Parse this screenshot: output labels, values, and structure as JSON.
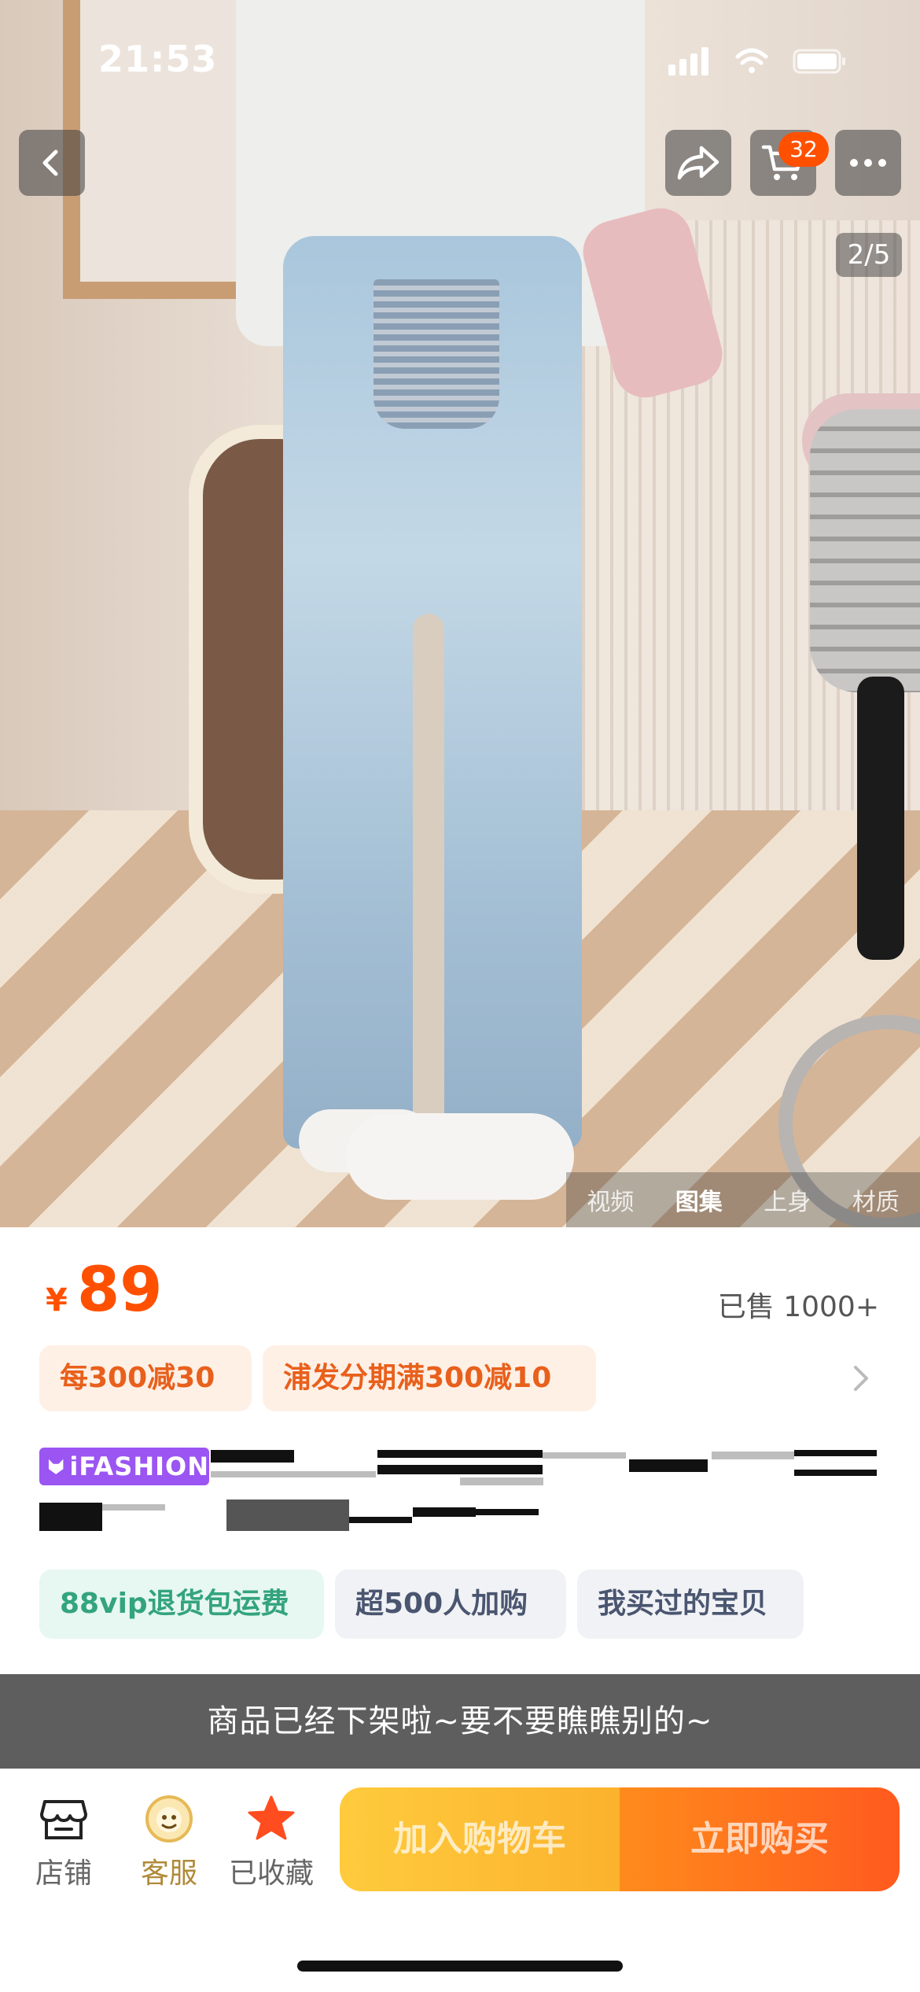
{
  "status_bar": {
    "time": "21:53"
  },
  "top_nav": {
    "cart_count": "32",
    "page_indicator": "2/5"
  },
  "media_tabs": [
    "视频",
    "图集",
    "上身",
    "材质"
  ],
  "product": {
    "currency": "¥",
    "price": "89",
    "sold": "已售 1000+",
    "promos": [
      "每300减30",
      "浦发分期满300减10"
    ],
    "brand_badge": "iFASHION",
    "tags": [
      "88vip退货包运费",
      "超500人加购",
      "我买过的宝贝"
    ]
  },
  "notice": "商品已经下架啦~要不要瞧瞧别的~",
  "bottom_bar": {
    "store_label": "店铺",
    "service_label": "客服",
    "favorite_label": "已收藏",
    "add_to_cart_label": "加入购物车",
    "buy_now_label": "立即购买"
  },
  "colors": {
    "accent": "#ff5000",
    "favorite_star": "#ff4d1f",
    "brand_badge": "#9b55f2"
  }
}
